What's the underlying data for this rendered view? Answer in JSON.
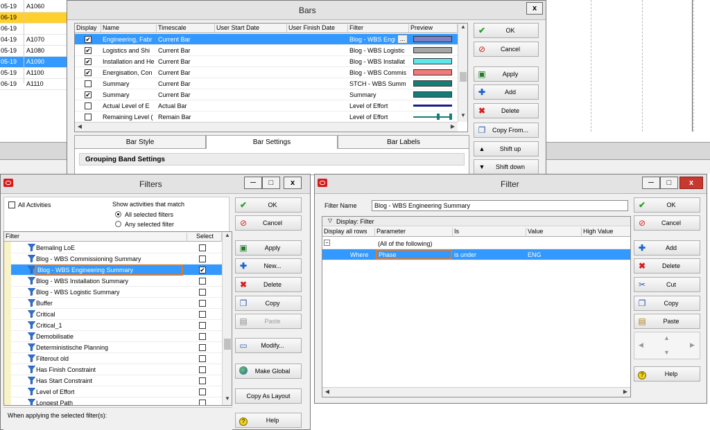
{
  "background": {
    "rows": [
      {
        "date": "05-19",
        "id": "A1060",
        "state": ""
      },
      {
        "date": "06-19",
        "id": "",
        "state": "yellow"
      },
      {
        "date": "06-19",
        "id": "",
        "state": ""
      },
      {
        "date": "04-19",
        "id": "A1070",
        "state": ""
      },
      {
        "date": "05-19",
        "id": "A1080",
        "state": ""
      },
      {
        "date": "05-19",
        "id": "A1090",
        "state": "blue"
      },
      {
        "date": "05-19",
        "id": "A1100",
        "state": ""
      },
      {
        "date": "06-19",
        "id": "A1110",
        "state": ""
      }
    ]
  },
  "bars": {
    "title": "Bars",
    "close": "x",
    "columns": [
      "Display",
      "Name",
      "Timescale",
      "User Start Date",
      "User Finish Date",
      "Filter",
      "Preview"
    ],
    "rows": [
      {
        "display": true,
        "name": "Engineering, Fabr",
        "timescale": "Current Bar",
        "filter": "Blog - WBS Engir",
        "filter_more": "...",
        "color": "#7d82c8",
        "style": "bar",
        "selected": true
      },
      {
        "display": true,
        "name": "Logistics and Shi",
        "timescale": "Current Bar",
        "filter": "Blog - WBS Logistic",
        "color": "#a6a6a6",
        "style": "bar",
        "selected": false
      },
      {
        "display": true,
        "name": "Installation and He",
        "timescale": "Current Bar",
        "filter": "Blog - WBS Installat",
        "color": "#5ee6ec",
        "style": "bar",
        "selected": false
      },
      {
        "display": true,
        "name": "Energisation, Con",
        "timescale": "Current Bar",
        "filter": "Blog - WBS Commis",
        "color": "#f07a7a",
        "style": "bar",
        "selected": false
      },
      {
        "display": false,
        "name": "Summary",
        "timescale": "Current Bar",
        "filter": "STCH - WBS Summ",
        "color": "#147d78",
        "style": "bar",
        "selected": false
      },
      {
        "display": true,
        "name": "Summary",
        "timescale": "Current Bar",
        "filter": "Summary",
        "color": "#147d78",
        "style": "bar",
        "selected": false
      },
      {
        "display": false,
        "name": "Actual Level of E",
        "timescale": "Actual Bar",
        "filter": "Level of Effort",
        "color": "#1a1a8c",
        "style": "line",
        "selected": false
      },
      {
        "display": false,
        "name": "Remaining Level (",
        "timescale": "Remain Bar",
        "filter": "Level of Effort",
        "color": "#147d78",
        "style": "endpoints",
        "selected": false
      }
    ],
    "buttons": {
      "ok": "OK",
      "cancel": "Cancel",
      "apply": "Apply",
      "add": "Add",
      "delete": "Delete",
      "copy_from": "Copy From...",
      "shift_up": "Shift up",
      "shift_down": "Shift down"
    },
    "tabs": [
      "Bar Style",
      "Bar Settings",
      "Bar Labels"
    ],
    "group_heading": "Grouping Band Settings"
  },
  "filters": {
    "title": "Filters",
    "minimize": "—",
    "maximize": "□",
    "close": "x",
    "all_activities": "All Activities",
    "show_label": "Show activities that match",
    "radio_all": "All selected filters",
    "radio_any": "Any selected filter",
    "col_filter": "Filter",
    "col_select": "Select",
    "rows": [
      {
        "name": "Bemaling LoE",
        "checked": false,
        "selected": false
      },
      {
        "name": "Blog - WBS Commissioning Summary",
        "checked": false,
        "selected": false
      },
      {
        "name": "Blog - WBS Engineering Summary",
        "checked": true,
        "selected": true
      },
      {
        "name": "Blog - WBS Installation Summary",
        "checked": false,
        "selected": false
      },
      {
        "name": "Blog - WBS Logistic Summary",
        "checked": false,
        "selected": false
      },
      {
        "name": "Buffer",
        "checked": false,
        "selected": false
      },
      {
        "name": "Critical",
        "checked": false,
        "selected": false
      },
      {
        "name": "Critical_1",
        "checked": false,
        "selected": false
      },
      {
        "name": "Demobilisatie",
        "checked": false,
        "selected": false
      },
      {
        "name": "Deterministische Planning",
        "checked": false,
        "selected": false
      },
      {
        "name": "Filterout old",
        "checked": false,
        "selected": false
      },
      {
        "name": "Has Finish Constraint",
        "checked": false,
        "selected": false
      },
      {
        "name": "Has Start Constraint",
        "checked": false,
        "selected": false
      },
      {
        "name": "Level of Effort",
        "checked": false,
        "selected": false
      },
      {
        "name": "Longest Path",
        "checked": false,
        "selected": false
      }
    ],
    "apply_label": "When applying the selected filter(s):",
    "buttons": {
      "ok": "OK",
      "cancel": "Cancel",
      "apply": "Apply",
      "new": "New...",
      "delete": "Delete",
      "copy": "Copy",
      "paste": "Paste",
      "modify": "Modify...",
      "make_global": "Make Global",
      "copy_as_layout": "Copy As Layout",
      "help": "Help"
    }
  },
  "filter": {
    "title": "Filter",
    "minimize": "—",
    "maximize": "□",
    "close": "x",
    "name_label": "Filter Name",
    "name_value": "Blog - WBS Engineering Summary",
    "display_label": "Display: Filter",
    "columns": [
      "Display all rows",
      "Parameter",
      "Is",
      "Value",
      "High Value"
    ],
    "group_row": "(All of the following)",
    "group_toggle": "−",
    "criteria": {
      "where": "Where",
      "parameter": "Phase",
      "is": "is under",
      "value": "ENG"
    },
    "buttons": {
      "ok": "OK",
      "cancel": "Cancel",
      "add": "Add",
      "delete": "Delete",
      "cut": "Cut",
      "copy": "Copy",
      "paste": "Paste",
      "help": "Help"
    }
  }
}
